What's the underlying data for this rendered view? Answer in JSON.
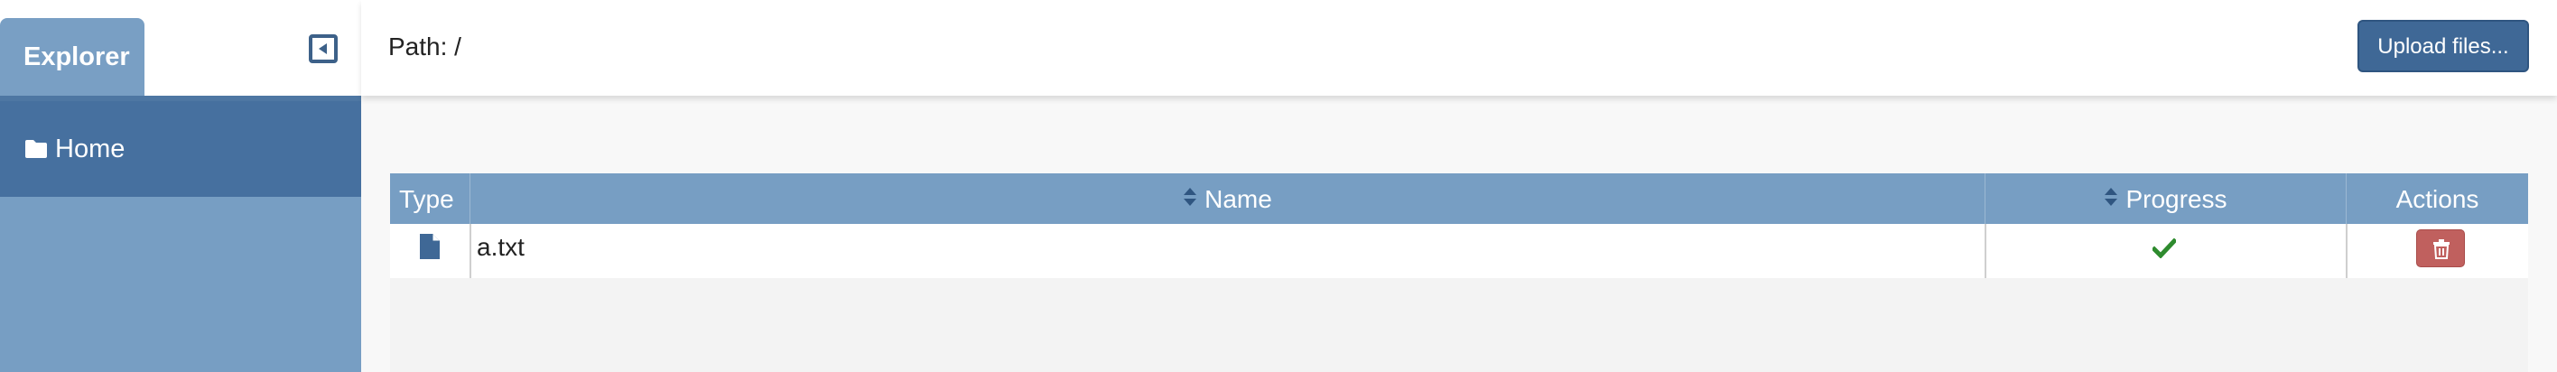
{
  "sidebar": {
    "tab_label": "Explorer",
    "collapse_icon": "collapse-left-icon",
    "items": [
      {
        "label": "Home",
        "icon": "folder-icon"
      }
    ]
  },
  "topbar": {
    "path_label": "Path: /",
    "upload_label": "Upload files..."
  },
  "table": {
    "columns": [
      "Type",
      "Name",
      "Progress",
      "Actions"
    ],
    "rows": [
      {
        "type_icon": "file-icon",
        "name": "a.txt",
        "progress_icon": "check-icon",
        "action_icon": "trash-icon"
      }
    ]
  },
  "colors": {
    "sidebar": "#779ec3",
    "sidebar_active": "#46709f",
    "primary_button": "#3f6896",
    "danger_button": "#c0605e",
    "success": "#2e8b2e"
  }
}
